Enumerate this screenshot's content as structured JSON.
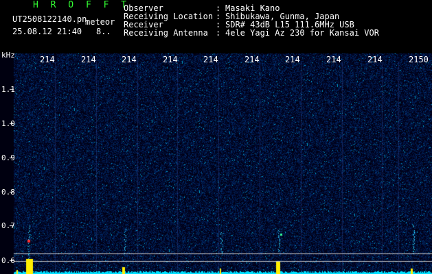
{
  "header": {
    "title": "H R O F F T",
    "filename": "UT2508122140.pn",
    "mode": "meteor",
    "datetime": "25.08.12 21:40",
    "count": "8.."
  },
  "info": {
    "labels": [
      "Observer",
      "Receiving Location",
      "Receiver",
      "Receiving Antenna"
    ],
    "separator": ":",
    "values": [
      "Masaki Kano",
      "Shibukawa, Gunma, Japan",
      "SDR# 43dB L15 111.6MHz USB",
      "4ele Yagi Az 230 for Kansai VOR"
    ]
  },
  "axis": {
    "unit": "kHz",
    "ticks": [
      "1.1",
      "1.0",
      "0.9",
      "0.8",
      "0.7",
      "0.6"
    ],
    "time_labels": [
      "214",
      "214",
      "214",
      "214",
      "214",
      "214",
      "214",
      "214",
      "214",
      "2150"
    ]
  },
  "colors": {
    "background": "#000010",
    "noise": "#1a2aa8",
    "signal": "#00e0ff",
    "hot": "#ff3030",
    "peak": "#ffee00"
  }
}
